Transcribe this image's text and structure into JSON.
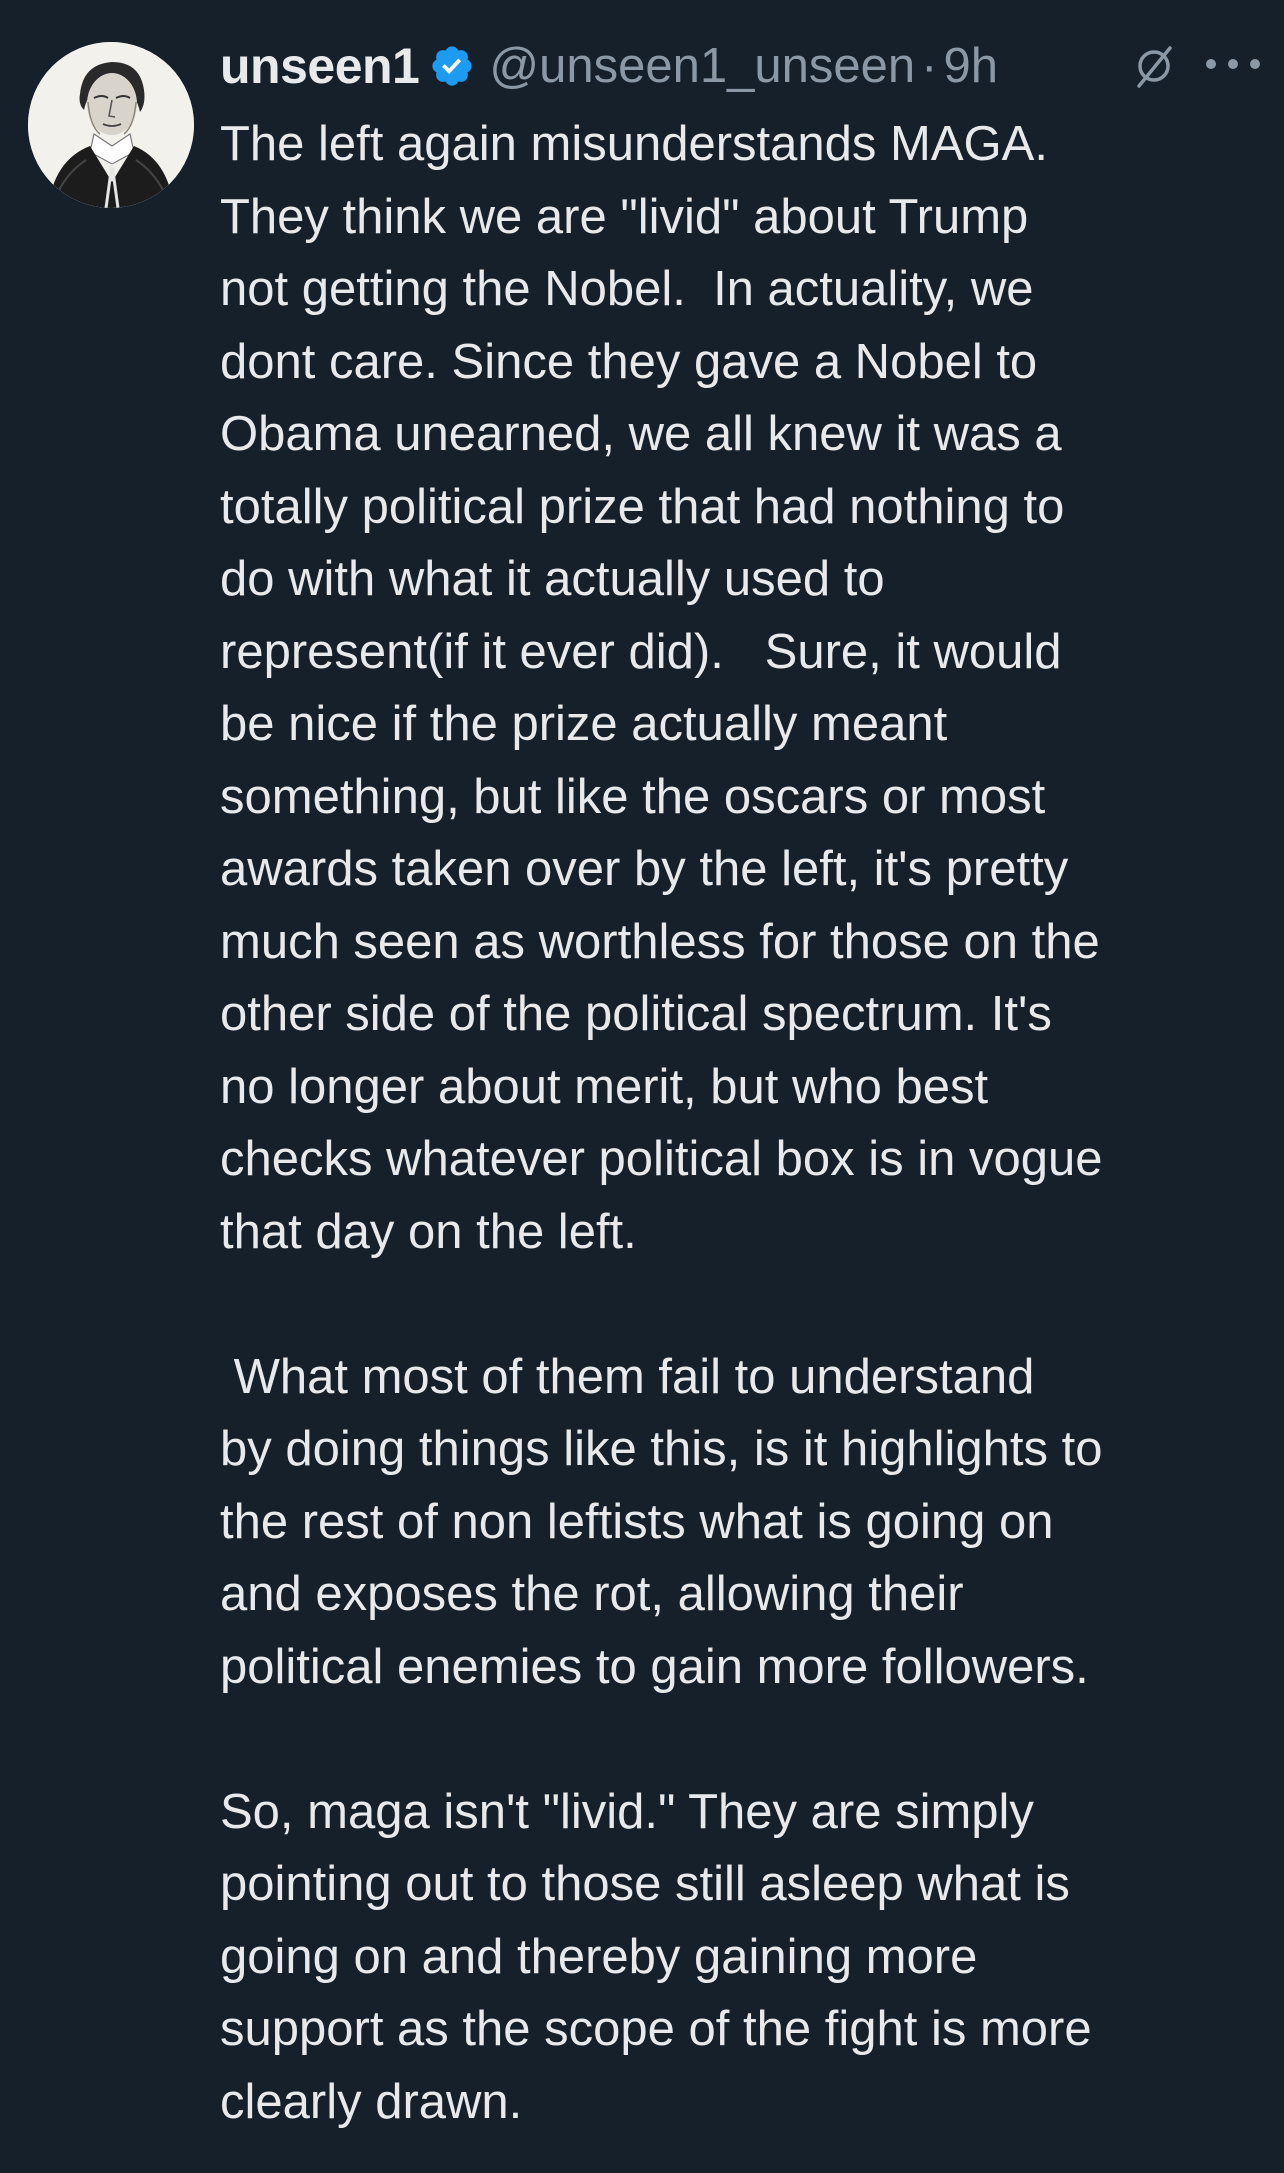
{
  "tweet": {
    "author": {
      "display_name": "unseen1",
      "handle": "@unseen1_unseen",
      "separator": "·",
      "time": "9h",
      "verified": true,
      "avatar_icon": "portrait-engraving-avatar",
      "verified_icon": "verified-badge-icon"
    },
    "actions": {
      "grok_icon": "grok-slash-icon",
      "more_icon": "more-options-icon"
    },
    "text": "The left again misunderstands MAGA.\nThey think we are \"livid\" about Trump\nnot getting the Nobel.  In actuality, we\ndont care. Since they gave a Nobel to\nObama unearned, we all knew it was a\ntotally political prize that had nothing to\ndo with what it actually used to\nrepresent(if it ever did).   Sure, it would\nbe nice if the prize actually meant\nsomething, but like the oscars or most\nawards taken over by the left, it's pretty\nmuch seen as worthless for those on the\nother side of the political spectrum. It's\nno longer about merit, but who best\nchecks whatever political box is in vogue\nthat day on the left.\n\n What most of them fail to understand\nby doing things like this, is it highlights to\nthe rest of non leftists what is going on\nand exposes the rot, allowing their\npolitical enemies to gain more followers.\n\nSo, maga isn't \"livid.\" They are simply\npointing out to those still asleep what is\ngoing on and thereby gaining more\nsupport as the scope of the fight is more\nclearly drawn."
  },
  "colors": {
    "background": "#15202b",
    "text_primary": "#e7e9ea",
    "text_secondary": "#8b98a5",
    "verified_blue": "#1d9bf0"
  }
}
